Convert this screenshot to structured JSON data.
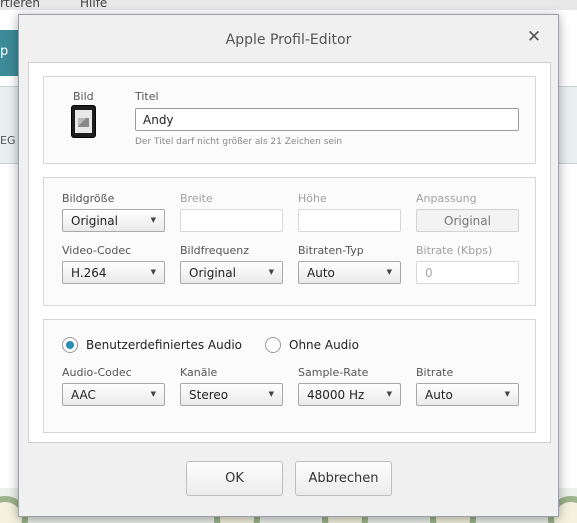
{
  "background": {
    "menu": [
      "rtieren",
      "Hilfe"
    ],
    "teal_tab": "p",
    "side_label": "EG"
  },
  "dialog": {
    "title": "Apple Profil-Editor",
    "close_symbol": "✕"
  },
  "profile": {
    "image_label": "Bild",
    "image_icon": "tablet-icon",
    "title_label": "Titel",
    "title_value": "Andy",
    "title_hint": "Der Titel darf nicht größer als 21 Zeichen sein"
  },
  "video": {
    "bildgroesse_label": "Bildgröße",
    "bildgroesse_value": "Original",
    "breite_label": "Breite",
    "breite_value": "",
    "hoehe_label": "Höhe",
    "hoehe_value": "",
    "anpassung_label": "Anpassung",
    "anpassung_value": "Original",
    "codec_label": "Video-Codec",
    "codec_value": "H.264",
    "framerate_label": "Bildfrequenz",
    "framerate_value": "Original",
    "bitrate_type_label": "Bitraten-Typ",
    "bitrate_type_value": "Auto",
    "bitrate_label": "Bitrate (Kbps)",
    "bitrate_value": "0"
  },
  "audio": {
    "custom_label": "Benutzerdefiniertes Audio",
    "custom_selected": true,
    "none_label": "Ohne Audio",
    "codec_label": "Audio-Codec",
    "codec_value": "AAC",
    "channels_label": "Kanäle",
    "channels_value": "Stereo",
    "samplerate_label": "Sample-Rate",
    "samplerate_value": "48000 Hz",
    "bitrate_label": "Bitrate",
    "bitrate_value": "Auto"
  },
  "buttons": {
    "ok": "OK",
    "cancel": "Abbrechen"
  },
  "colors": {
    "accent": "#2a8fb0",
    "background_teal": "#3d8a99"
  }
}
